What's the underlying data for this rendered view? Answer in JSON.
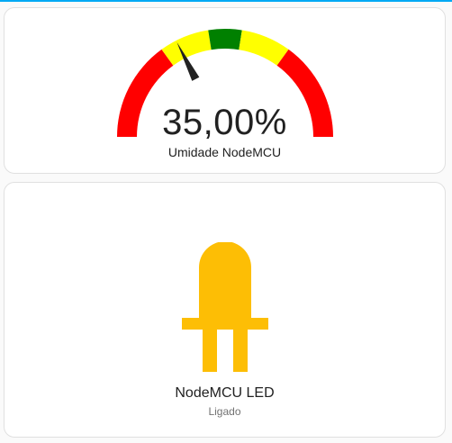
{
  "accent_color": "#03a9f4",
  "gauge_card": {
    "value": 35,
    "min": 0,
    "max": 100,
    "value_text": "35,00%",
    "name": "Umidade NodeMCU",
    "segments": [
      {
        "from": 0,
        "to": 30,
        "color": "#ff0000"
      },
      {
        "from": 30,
        "to": 45,
        "color": "#ffff00"
      },
      {
        "from": 45,
        "to": 55,
        "color": "#008000"
      },
      {
        "from": 55,
        "to": 70,
        "color": "#ffff00"
      },
      {
        "from": 70,
        "to": 100,
        "color": "#ff0000"
      }
    ],
    "needle_color": "#222222"
  },
  "light_card": {
    "icon": "led-on-icon",
    "icon_color": "#fdbe05",
    "name": "NodeMCU LED",
    "state": "Ligado"
  }
}
